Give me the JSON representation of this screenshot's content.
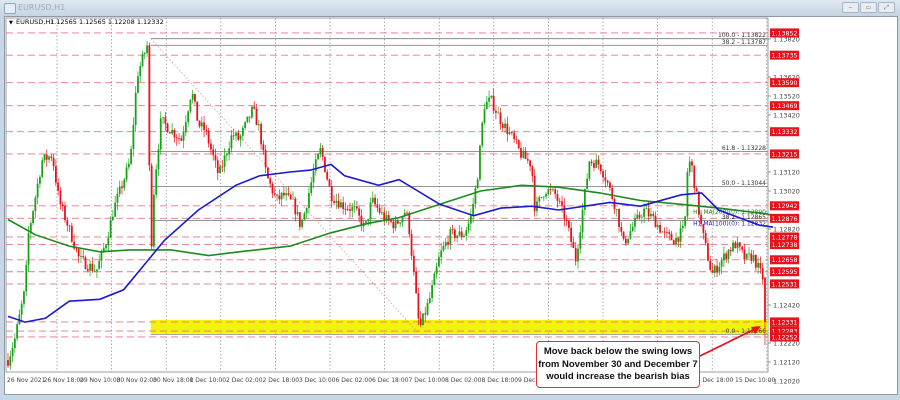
{
  "window": {
    "title": "EURUSD,H1",
    "minimize": "‒",
    "restore": "▭",
    "maximize": "⤢"
  },
  "chart_header": {
    "symbol": "EURUSD,H1",
    "ohlc": "1.12565 1.12565 1.12208 1.12332"
  },
  "annotation": {
    "lines": [
      "Move back below the swing lows",
      "from November 30 and December 7",
      "would increase the bearish bias"
    ]
  },
  "chart_data": {
    "type": "candlestick",
    "symbol": "EURUSD",
    "timeframe": "H1",
    "last_bar": {
      "open": 1.12565,
      "high": 1.12565,
      "low": 1.12208,
      "close": 1.12332
    },
    "ylim": [
      1.12,
      1.139
    ],
    "y_ticks": [
      "1.13820",
      "1.13620",
      "1.13520",
      "1.13420",
      "1.13120",
      "1.13020",
      "1.12820",
      "1.12420",
      "1.12220",
      "1.12120",
      "1.12020"
    ],
    "x_ticks": [
      "26 Nov 2021",
      "26 Nov 18:00",
      "29 Nov 10:00",
      "30 Nov 02:00",
      "30 Nov 18:00",
      "1 Dec 10:00",
      "2 Dec 02:00",
      "2 Dec 18:00",
      "3 Dec 10:00",
      "6 Dec 02:00",
      "6 Dec 18:00",
      "7 Dec 10:00",
      "8 Dec 02:00",
      "8 Dec 18:00",
      "9 Dec 10:00",
      "14 Dec 18:00",
      "15 Dec 10:00"
    ],
    "horizontal_levels": [
      "1.13852",
      "1.13735",
      "1.13590",
      "1.13469",
      "1.13332",
      "1.13215",
      "1.12942",
      "1.12876",
      "1.12778",
      "1.12738",
      "1.12658",
      "1.12595",
      "1.12531",
      "1.12331",
      "1.12283",
      "1.12252"
    ],
    "level_color": "#e8121c",
    "fibonacci": [
      {
        "label": "100.0 - 1.13822",
        "price": 1.13822
      },
      {
        "label": "38.2 - 1.13787",
        "price": 1.13787
      },
      {
        "label": "61.8 - 1.13228",
        "price": 1.13228
      },
      {
        "label": "50.0 - 1.13044",
        "price": 1.13044
      },
      {
        "label": "38.2 - 1.12865",
        "price": 1.12865
      },
      {
        "label": "0.0 - 1.12266",
        "price": 1.12266
      }
    ],
    "fib_trend": {
      "from": [
        42,
        1.13822
      ],
      "to": [
        121,
        1.12266
      ]
    },
    "support_zone": {
      "from_t": 42,
      "low": 1.12283,
      "high": 1.12331,
      "color": "#f2f20a"
    },
    "price_path": [
      [
        0,
        1.1213
      ],
      [
        2,
        1.1224
      ],
      [
        5,
        1.125
      ],
      [
        6,
        1.1279
      ],
      [
        10,
        1.1318
      ],
      [
        13,
        1.1321
      ],
      [
        15,
        1.1297
      ],
      [
        18,
        1.1282
      ],
      [
        21,
        1.1266
      ],
      [
        26,
        1.126
      ],
      [
        29,
        1.1276
      ],
      [
        31,
        1.1292
      ],
      [
        36,
        1.1318
      ],
      [
        38,
        1.1363
      ],
      [
        41,
        1.1379
      ],
      [
        42,
        1.1266
      ],
      [
        43,
        1.1305
      ],
      [
        45,
        1.1339
      ],
      [
        48,
        1.1334
      ],
      [
        51,
        1.1329
      ],
      [
        54,
        1.1355
      ],
      [
        56,
        1.1337
      ],
      [
        58,
        1.1334
      ],
      [
        62,
        1.131
      ],
      [
        66,
        1.1332
      ],
      [
        68,
        1.1329
      ],
      [
        72,
        1.1345
      ],
      [
        74,
        1.1334
      ],
      [
        76,
        1.131
      ],
      [
        79,
        1.1297
      ],
      [
        81,
        1.13
      ],
      [
        84,
        1.1295
      ],
      [
        86,
        1.1284
      ],
      [
        87,
        1.1289
      ],
      [
        90,
        1.1313
      ],
      [
        92,
        1.1324
      ],
      [
        95,
        1.13
      ],
      [
        98,
        1.1295
      ],
      [
        102,
        1.1292
      ],
      [
        105,
        1.1282
      ],
      [
        107,
        1.1297
      ],
      [
        111,
        1.1287
      ],
      [
        114,
        1.1284
      ],
      [
        117,
        1.1292
      ],
      [
        118,
        1.1282
      ],
      [
        121,
        1.1229
      ],
      [
        124,
        1.1245
      ],
      [
        127,
        1.1268
      ],
      [
        130,
        1.1279
      ],
      [
        134,
        1.1279
      ],
      [
        136,
        1.1287
      ],
      [
        138,
        1.1308
      ],
      [
        140,
        1.1347
      ],
      [
        142,
        1.135
      ],
      [
        145,
        1.1339
      ],
      [
        148,
        1.1331
      ],
      [
        151,
        1.1321
      ],
      [
        154,
        1.1316
      ],
      [
        155,
        1.1292
      ],
      [
        158,
        1.1303
      ],
      [
        161,
        1.13
      ],
      [
        164,
        1.1287
      ],
      [
        167,
        1.1266
      ],
      [
        170,
        1.1305
      ],
      [
        171,
        1.1318
      ],
      [
        174,
        1.1316
      ],
      [
        176,
        1.1308
      ],
      [
        179,
        1.1292
      ],
      [
        181,
        1.1274
      ],
      [
        184,
        1.1284
      ],
      [
        187,
        1.1292
      ],
      [
        190,
        1.1287
      ],
      [
        193,
        1.1279
      ],
      [
        196,
        1.1276
      ],
      [
        199,
        1.1282
      ],
      [
        200,
        1.1318
      ],
      [
        201,
        1.1316
      ],
      [
        204,
        1.1282
      ],
      [
        206,
        1.1266
      ],
      [
        207,
        1.1258
      ],
      [
        209,
        1.1263
      ],
      [
        212,
        1.1271
      ],
      [
        214,
        1.1274
      ],
      [
        217,
        1.1266
      ],
      [
        219,
        1.1268
      ],
      [
        221,
        1.126
      ],
      [
        222,
        1.12565
      ],
      [
        223,
        1.12332
      ]
    ],
    "moving_averages": [
      {
        "name": "H1 MA(200)(0): 1.12890",
        "color": "#1e8a1e",
        "points": [
          [
            0,
            1.1287
          ],
          [
            8,
            1.1279
          ],
          [
            18,
            1.1273
          ],
          [
            27,
            1.127
          ],
          [
            36,
            1.1271
          ],
          [
            48,
            1.1271
          ],
          [
            59,
            1.1268
          ],
          [
            68,
            1.127
          ],
          [
            83,
            1.1273
          ],
          [
            95,
            1.128
          ],
          [
            106,
            1.1285
          ],
          [
            115,
            1.1288
          ],
          [
            127,
            1.1295
          ],
          [
            139,
            1.1302
          ],
          [
            151,
            1.1305
          ],
          [
            162,
            1.1304
          ],
          [
            174,
            1.1301
          ],
          [
            186,
            1.1297
          ],
          [
            198,
            1.1295
          ],
          [
            209,
            1.1293
          ],
          [
            223,
            1.129
          ],
          [
            225,
            1.1289
          ]
        ]
      },
      {
        "name": "H1 MA(100)(0): 1.12832",
        "color": "#1a1ad0",
        "points": [
          [
            0,
            1.1236
          ],
          [
            5,
            1.1233
          ],
          [
            11,
            1.1235
          ],
          [
            18,
            1.1244
          ],
          [
            27,
            1.1245
          ],
          [
            34,
            1.125
          ],
          [
            40,
            1.1263
          ],
          [
            46,
            1.1276
          ],
          [
            56,
            1.1292
          ],
          [
            67,
            1.1305
          ],
          [
            74,
            1.131
          ],
          [
            83,
            1.1312
          ],
          [
            89,
            1.1313
          ],
          [
            95,
            1.1316
          ],
          [
            99,
            1.131
          ],
          [
            109,
            1.1305
          ],
          [
            115,
            1.1308
          ],
          [
            127,
            1.1295
          ],
          [
            137,
            1.1289
          ],
          [
            145,
            1.1293
          ],
          [
            154,
            1.1294
          ],
          [
            162,
            1.1292
          ],
          [
            177,
            1.1296
          ],
          [
            186,
            1.1294
          ],
          [
            198,
            1.13
          ],
          [
            204,
            1.1301
          ],
          [
            209,
            1.1292
          ],
          [
            221,
            1.1284
          ],
          [
            225,
            1.1283
          ]
        ]
      }
    ]
  }
}
